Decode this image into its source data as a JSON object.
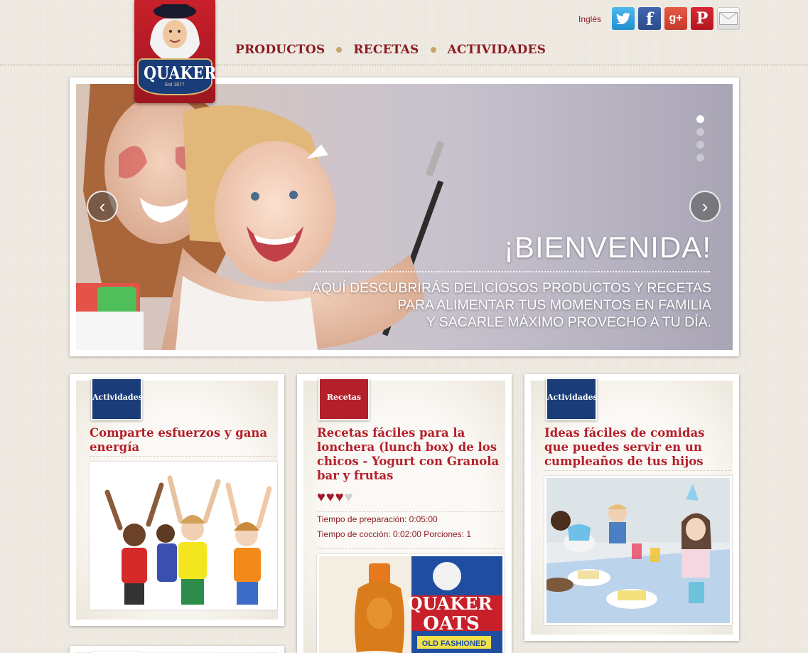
{
  "header": {
    "logo": {
      "text": "QUAKER",
      "est": "Est 1877"
    },
    "nav": [
      "PRODUCTOS",
      "RECETAS",
      "ACTIVIDADES"
    ],
    "language": "Inglés",
    "social_icons": [
      "twitter-icon",
      "facebook-icon",
      "google-plus-icon",
      "pinterest-icon",
      "mail-icon"
    ]
  },
  "slider": {
    "title": "¡BIENVENIDA!",
    "body_lines": [
      "Aquí descubrirás deliciosos productos y recetas",
      "para alimentar tus momentos en familia",
      "y sacarle máximo provecho a tu día."
    ],
    "prev_label": "‹",
    "next_label": "›",
    "slide_count": 4,
    "active_slide": 1
  },
  "cards": [
    {
      "tag": "Actividades",
      "title": "Comparte esfuerzos y gana energía",
      "image": "children-cheering-photo"
    },
    {
      "tag": "Recetas",
      "title": "Recetas fáciles para la lonchera (lunch box) de los chicos - Yogurt con Granola bar y frutas",
      "rating": 3,
      "rating_max": 4,
      "prep_time": "Tiempo de preparación: 0:05:00",
      "cook_time": "Tiempo de cocción: 0:02:00 Porciones: 1",
      "image": "quaker-oats-honey-photo",
      "product_text": {
        "brand": "QUAKER",
        "line": "OATS",
        "variant": "OLD FASHIONED"
      }
    },
    {
      "tag": "Actividades",
      "title": "Ideas fáciles de comidas que puedes servir en un cumpleaños de tus hijos",
      "image": "kids-birthday-party-photo"
    }
  ],
  "colors": {
    "brand_red": "#b3202a",
    "nav_red": "#8b1c24",
    "brand_blue": "#1a3c78",
    "background": "#f1ece3"
  }
}
